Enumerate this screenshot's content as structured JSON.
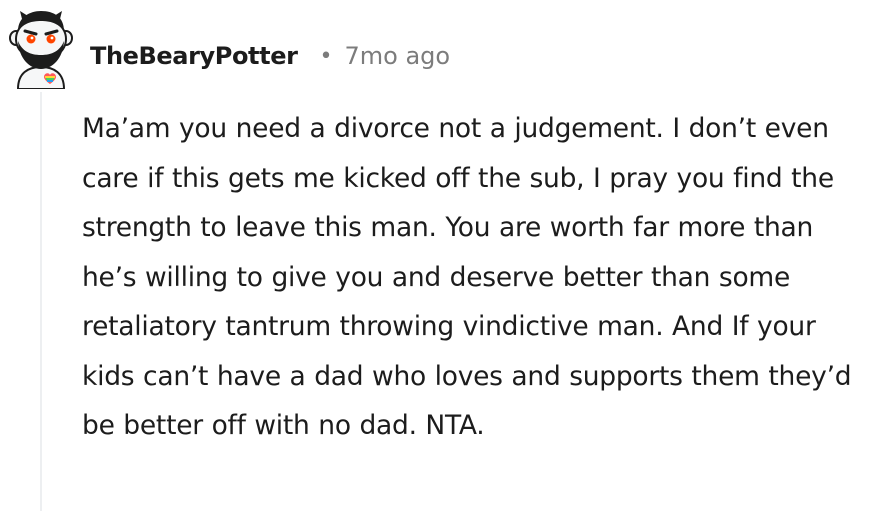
{
  "comment": {
    "author": "TheBearyPotter",
    "separator": "•",
    "timestamp": "7mo ago",
    "body": "Ma’am you need a divorce not a judgement. I don’t even care if this gets me kicked off the sub, I pray you find the strength to leave this man. You are worth far more than he’s willing to give you and deserve better than some retaliatory tantrum throwing vindictive man. And If your kids can’t have a dad who loves and supports them they’d be better off with no dad. NTA."
  },
  "avatar": {
    "icon": "snoo-avatar-icon",
    "skin_color": "#ffffff",
    "beard_color": "#1c1c1c",
    "eye_color": "#ff4500",
    "badge": "rainbow-heart"
  },
  "colors": {
    "text": "#1c1c1c",
    "meta": "#7c7c7c",
    "thread_line": "#edeff1"
  }
}
